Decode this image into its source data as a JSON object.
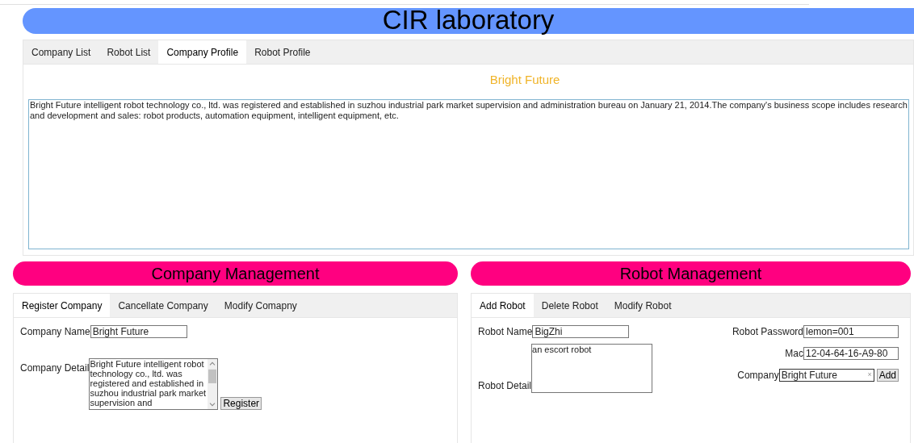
{
  "title": "CIR laboratory",
  "main_tabs": [
    {
      "label": "Company List",
      "selected": false
    },
    {
      "label": "Robot List",
      "selected": false
    },
    {
      "label": "Company Profile",
      "selected": true
    },
    {
      "label": "Robot Profile",
      "selected": false
    }
  ],
  "profile": {
    "name": "Bright Future",
    "description": "Bright Future intelligent robot technology co., ltd. was registered and established in suzhou industrial park market supervision and administration bureau on January 21, 2014.The company's business scope includes research and development and sales: robot products, automation equipment, intelligent equipment, etc."
  },
  "company_management": {
    "title": "Company Management",
    "tabs": [
      {
        "label": "Register Company",
        "selected": true
      },
      {
        "label": "Cancellate Company",
        "selected": false
      },
      {
        "label": "Modify Comapny",
        "selected": false
      }
    ],
    "company_name": {
      "label": "Company Name",
      "value": "Bright Future"
    },
    "company_detail": {
      "label": "Company Detail",
      "value": "Bright Future intelligent robot technology co., ltd. was registered and established in suzhou industrial park market supervision and"
    },
    "button": "Register"
  },
  "robot_management": {
    "title": "Robot Management",
    "tabs": [
      {
        "label": "Add Robot",
        "selected": true
      },
      {
        "label": "Delete Robot",
        "selected": false
      },
      {
        "label": "Modify Robot",
        "selected": false
      }
    ],
    "robot_name": {
      "label": "Robot Name",
      "value": "BigZhi"
    },
    "robot_detail": {
      "label": "Robot Detail",
      "value": "an escort robot"
    },
    "robot_password": {
      "label": "Robot Password",
      "value": "lemon=001"
    },
    "mac": {
      "label": "Mac",
      "value": "12-04-64-16-A9-80"
    },
    "company": {
      "label": "Company",
      "value": "Bright Future",
      "clear": "×"
    },
    "button": "Add"
  }
}
